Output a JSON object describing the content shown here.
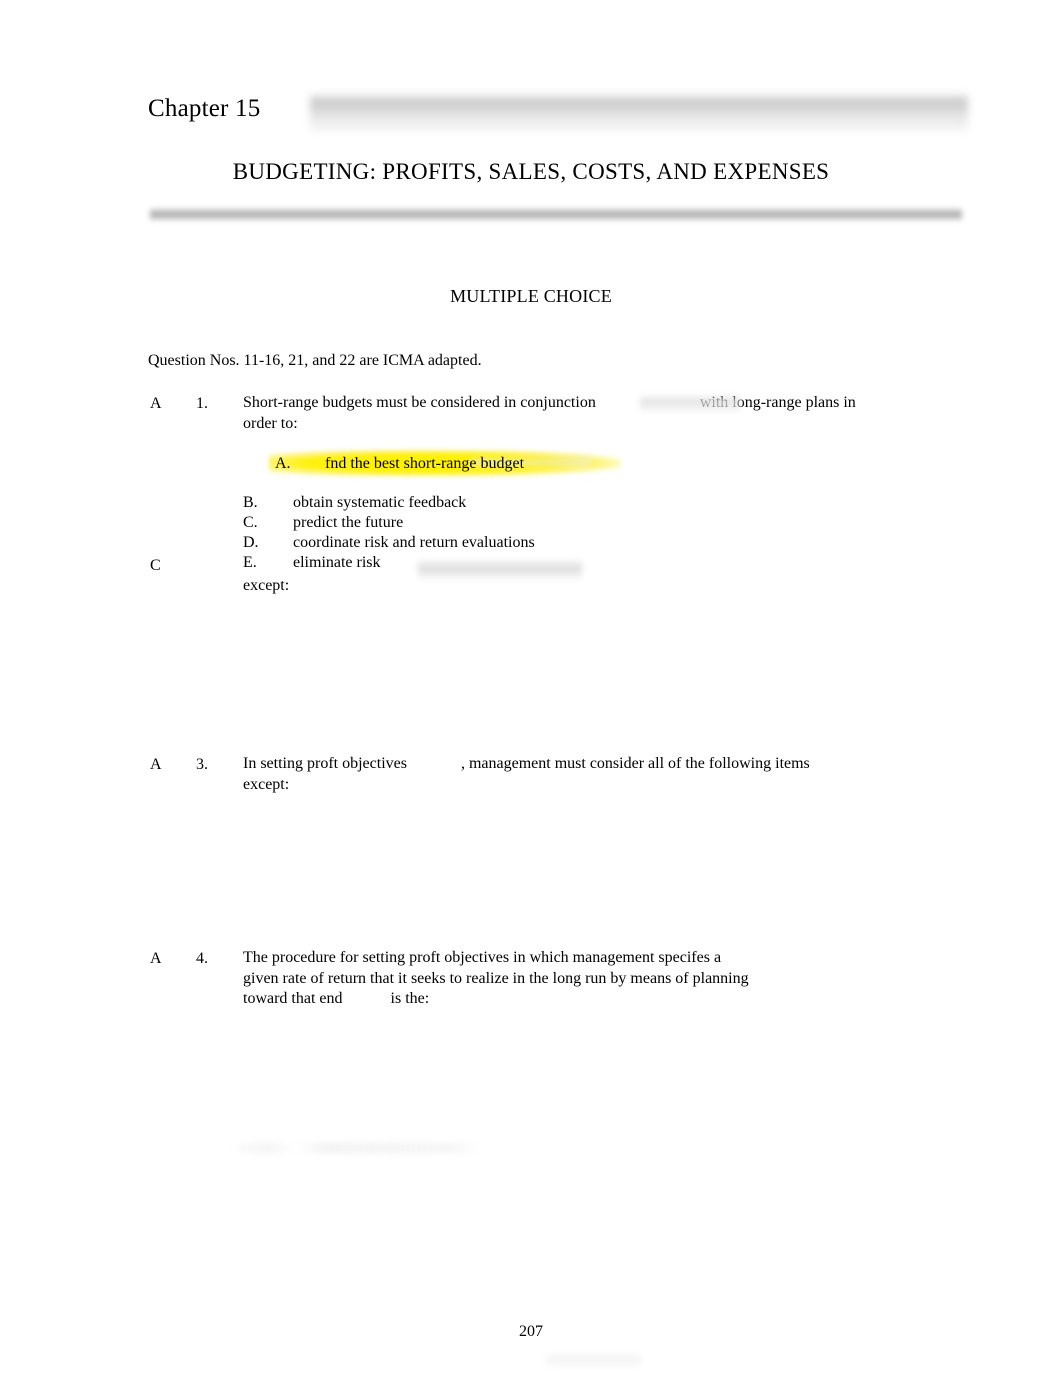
{
  "document": {
    "chapter_label": "Chapter 15",
    "title": "BUDGETING: PROFITS, SALES, COSTS, AND EXPENSES",
    "section_heading": "MULTIPLE CHOICE",
    "source_note": "Question Nos. 11-16, 21, and 22 are ICMA adapted.",
    "page_number": "207"
  },
  "colors": {
    "highlight": "#fff200",
    "text": "#000000",
    "redaction_gray": "#c6c6c6",
    "rule_gray": "#b0b0b0",
    "page_background": "#ffffff"
  },
  "questions": [
    {
      "answer_key": "A",
      "number": "1.",
      "stem_line_1_before_gap": "Short-range budgets must be considered in conjunction",
      "stem_line_1_after_gap": "with long-range plans in",
      "stem_line_2": "order to:",
      "options": [
        {
          "letter": "A.",
          "text": "fnd the best short-range budget",
          "highlighted": true
        },
        {
          "letter": "B.",
          "text": "obtain systematic feedback",
          "highlighted": false
        },
        {
          "letter": "C.",
          "text": "predict the future",
          "highlighted": false
        },
        {
          "letter": "D.",
          "text": "coordinate risk and return evaluations",
          "highlighted": false
        },
        {
          "letter": "E.",
          "text": "eliminate risk",
          "highlighted": false
        }
      ]
    },
    {
      "answer_key": "C",
      "number": "",
      "stem_line_1_before_gap": "",
      "stem_line_1_after_gap": "",
      "stem_line_2": "except:",
      "options": []
    },
    {
      "answer_key": "A",
      "number": "3.",
      "stem_line_1_before_gap": "In setting proft objectives",
      "stem_line_1_after_gap": ", management must consider all of the following items",
      "stem_line_2": "except:",
      "options": []
    },
    {
      "answer_key": "A",
      "number": "4.",
      "stem_line_1": "The procedure for setting proft objectives in which management specifes a",
      "stem_line_2": "given rate of return that it seeks to realize in the long run by means of planning",
      "stem_line_3_before_gap": "toward that end",
      "stem_line_3_after_gap": "is the:",
      "options": []
    }
  ]
}
